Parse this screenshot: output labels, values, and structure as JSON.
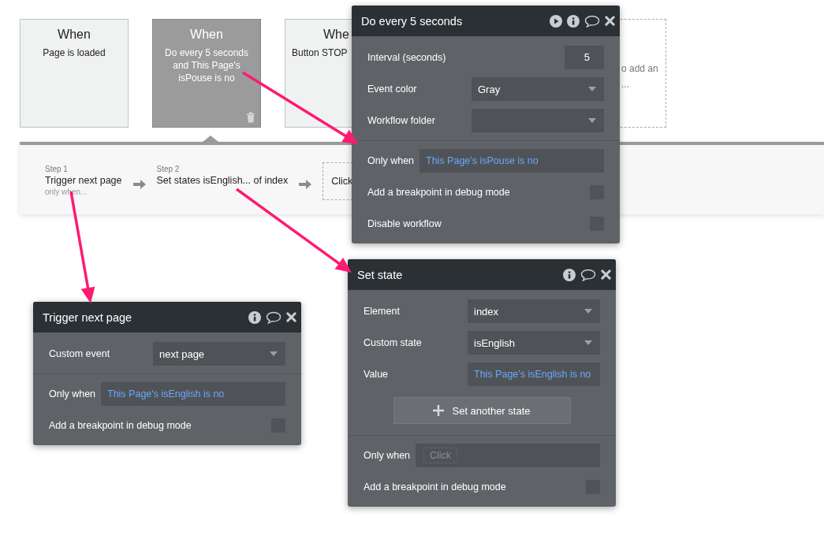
{
  "events": [
    {
      "title": "When",
      "text": "Page is loaded",
      "selected": false,
      "kind": "full"
    },
    {
      "title": "When",
      "text": "Do every 5 seconds and This Page's isPouse is no",
      "selected": true,
      "kind": "full"
    },
    {
      "title": "Whe",
      "text": "Button STOP",
      "selected": false,
      "kind": "partial"
    },
    {
      "text": "o add an",
      "text2": "...",
      "kind": "add"
    }
  ],
  "steps": [
    {
      "label": "Step 1",
      "name": "Trigger next page",
      "note": "only when..."
    },
    {
      "label": "Step 2",
      "name": "Set states isEnglish... of index"
    }
  ],
  "add_step": "Click",
  "panels": [
    {
      "title": "Do every 5 seconds",
      "runnable": true,
      "sections": [
        [
          {
            "kind": "number",
            "label": "Interval (seconds)",
            "value": "5"
          },
          {
            "kind": "dropdown",
            "label": "Event color",
            "value": "Gray"
          },
          {
            "kind": "dropdown",
            "label": "Workflow folder"
          }
        ],
        [
          {
            "kind": "condition",
            "label": "Only when",
            "value": "This Page's isPouse is no"
          },
          {
            "kind": "checkbox",
            "label": "Add a breakpoint in debug mode",
            "checked": false
          },
          {
            "kind": "checkbox",
            "label": "Disable workflow",
            "checked": false
          }
        ]
      ]
    },
    {
      "title": "Trigger next page",
      "runnable": false,
      "sections": [
        [
          {
            "kind": "dropdown",
            "label": "Custom event",
            "value": "next page"
          }
        ],
        [
          {
            "kind": "condition",
            "label": "Only when",
            "value": "This Page's isEnglish is no"
          },
          {
            "kind": "checkbox",
            "label": "Add a breakpoint in debug mode",
            "checked": false
          }
        ]
      ]
    },
    {
      "title": "Set state",
      "runnable": false,
      "sections": [
        [
          {
            "kind": "dropdown",
            "label": "Element",
            "value": "index"
          },
          {
            "kind": "dropdown",
            "label": "Custom state",
            "value": "isEnglish"
          },
          {
            "kind": "condition",
            "label": "Value",
            "value": "This Page's isEnglish is no"
          },
          {
            "kind": "button",
            "label": "Set another state"
          }
        ],
        [
          {
            "kind": "condition",
            "label": "Only when",
            "placeholder": "Click"
          },
          {
            "kind": "checkbox",
            "label": "Add a breakpoint in debug mode",
            "checked": false
          }
        ]
      ]
    }
  ]
}
